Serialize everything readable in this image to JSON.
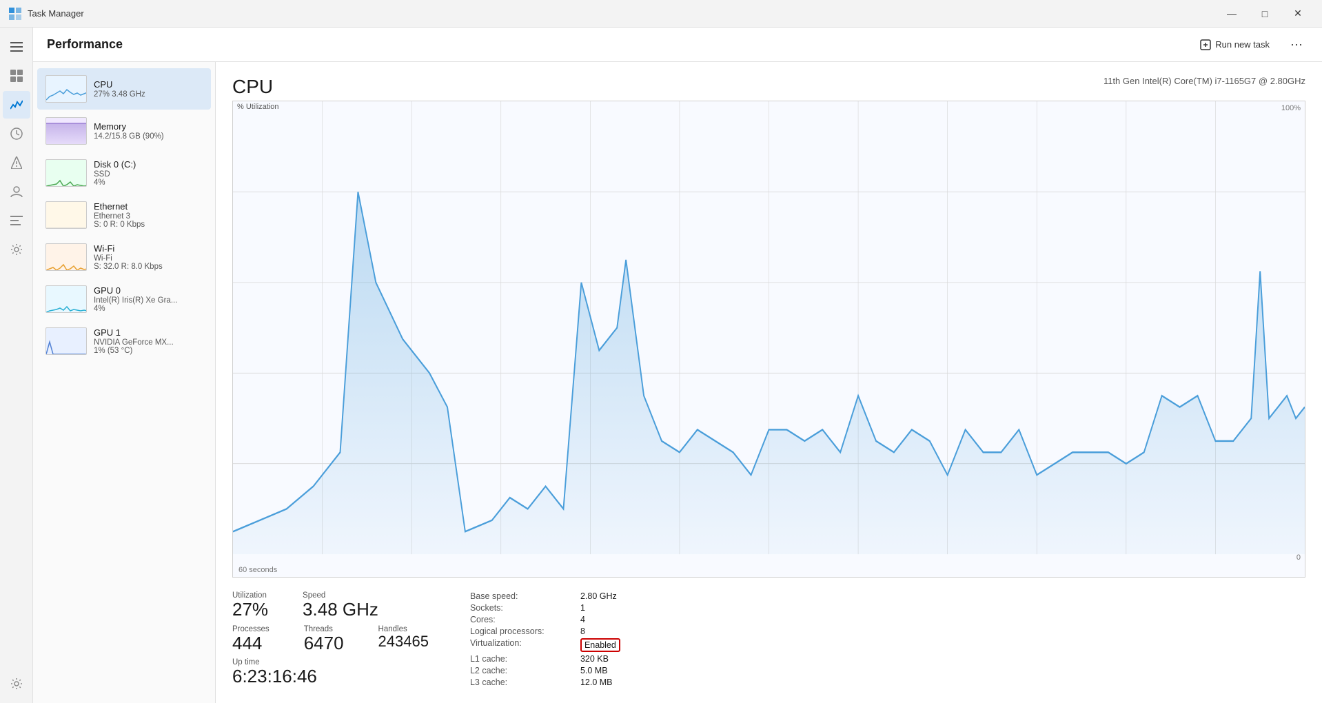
{
  "titlebar": {
    "title": "Task Manager",
    "minimize": "—",
    "maximize": "□",
    "close": "✕"
  },
  "header": {
    "title": "Performance",
    "run_new_task": "Run new task",
    "more_options": "···"
  },
  "sidebar": {
    "items": [
      {
        "id": "cpu",
        "title": "CPU",
        "sub": "27%  3.48 GHz",
        "thumb_type": "cpu"
      },
      {
        "id": "memory",
        "title": "Memory",
        "sub": "14.2/15.8 GB (90%)",
        "thumb_type": "memory"
      },
      {
        "id": "disk",
        "title": "Disk 0 (C:)",
        "sub": "SSD\n4%",
        "thumb_type": "disk"
      },
      {
        "id": "ethernet",
        "title": "Ethernet",
        "sub": "Ethernet 3\nS: 0 R: 0 Kbps",
        "thumb_type": "ethernet"
      },
      {
        "id": "wifi",
        "title": "Wi-Fi",
        "sub": "Wi-Fi\nS: 32.0 R: 8.0 Kbps",
        "thumb_type": "wifi"
      },
      {
        "id": "gpu0",
        "title": "GPU 0",
        "sub": "Intel(R) Iris(R) Xe Gra...\n4%",
        "thumb_type": "gpu0"
      },
      {
        "id": "gpu1",
        "title": "GPU 1",
        "sub": "NVIDIA GeForce MX...\n1% (53 °C)",
        "thumb_type": "gpu1"
      }
    ]
  },
  "panel": {
    "title": "CPU",
    "subtitle": "11th Gen Intel(R) Core(TM) i7-1165G7 @ 2.80GHz",
    "axis_label": "% Utilization",
    "y_max": "100%",
    "y_zero": "0",
    "x_label": "60 seconds"
  },
  "stats": {
    "utilization_label": "Utilization",
    "utilization_value": "27%",
    "speed_label": "Speed",
    "speed_value": "3.48 GHz",
    "processes_label": "Processes",
    "processes_value": "444",
    "threads_label": "Threads",
    "threads_value": "6470",
    "handles_label": "Handles",
    "handles_value": "243465",
    "uptime_label": "Up time",
    "uptime_value": "6:23:16:46"
  },
  "cpu_details": {
    "base_speed_label": "Base speed:",
    "base_speed_value": "2.80 GHz",
    "sockets_label": "Sockets:",
    "sockets_value": "1",
    "cores_label": "Cores:",
    "cores_value": "4",
    "logical_label": "Logical processors:",
    "logical_value": "8",
    "virt_label": "Virtualization:",
    "virt_value": "Enabled",
    "l1_label": "L1 cache:",
    "l1_value": "320 KB",
    "l2_label": "L2 cache:",
    "l2_value": "5.0 MB",
    "l3_label": "L3 cache:",
    "l3_value": "12.0 MB"
  },
  "nav_icons": [
    {
      "id": "menu",
      "symbol": "☰",
      "active": false
    },
    {
      "id": "processes",
      "symbol": "⊞",
      "active": false
    },
    {
      "id": "performance",
      "symbol": "📊",
      "active": true
    },
    {
      "id": "history",
      "symbol": "🕐",
      "active": false
    },
    {
      "id": "startup",
      "symbol": "⚡",
      "active": false
    },
    {
      "id": "users",
      "symbol": "👤",
      "active": false
    },
    {
      "id": "details",
      "symbol": "☰",
      "active": false
    },
    {
      "id": "services",
      "symbol": "⚙",
      "active": false
    }
  ]
}
